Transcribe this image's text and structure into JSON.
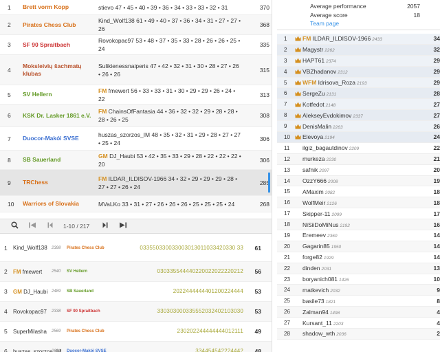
{
  "colors": {
    "title_gold": "#d59020",
    "accent_blue": "#3692e7",
    "team_green": "#629924",
    "team_orange": "#d87019"
  },
  "teams": [
    {
      "rank": "1",
      "name": "Brett vorm Kopp",
      "color": "c-orange",
      "players_title": "",
      "players": "stievo 47 • 45 • 40 • 39 • 36 • 34 • 33 • 33 • 32 • 31",
      "score": "370"
    },
    {
      "rank": "2",
      "name": "Pirates Chess Club",
      "color": "c-orange",
      "players_title": "",
      "players": "Kind_Wolf138 61 • 49 • 40 • 37 • 36 • 34 • 31 • 27 • 27 • 26",
      "score": "368"
    },
    {
      "rank": "3",
      "name": "SF 90 Spraitbach",
      "color": "c-red",
      "players_title": "",
      "players": "Rovokopac97 53 • 48 • 37 • 35 • 33 • 28 • 26 • 26 • 25 • 24",
      "score": "335"
    },
    {
      "rank": "4",
      "name": "Moksleivių šachmatų klubas",
      "color": "c-brown",
      "players_title": "",
      "players": "Sulikienessnaiperis 47 • 42 • 32 • 31 • 30 • 28 • 27 • 26 • 26 • 26",
      "score": "315"
    },
    {
      "rank": "5",
      "name": "SV Hellern",
      "color": "c-green",
      "players_title": "FM",
      "players": "fmewert 56 • 33 • 33 • 31 • 30 • 29 • 29 • 26 • 24 • 22",
      "score": "313"
    },
    {
      "rank": "6",
      "name": "KSK Dr. Lasker 1861 e.V.",
      "color": "c-green",
      "players_title": "FM",
      "players": "ChainsOfFantasia 44 • 36 • 32 • 32 • 29 • 28 • 28 • 28 • 26 • 25",
      "score": "308"
    },
    {
      "rank": "7",
      "name": "Duocor-Makói SVSE",
      "color": "c-blue",
      "players_title": "",
      "players": "huszas_szorzos_IM 48 • 35 • 32 • 31 • 29 • 28 • 27 • 27 • 25 • 24",
      "score": "306"
    },
    {
      "rank": "8",
      "name": "SB Sauerland",
      "color": "c-green",
      "players_title": "GM",
      "players": "DJ_Haubi 53 • 42 • 35 • 33 • 29 • 28 • 22 • 22 • 22 • 20",
      "score": "306"
    },
    {
      "rank": "9",
      "name": "TRChess",
      "color": "c-orange",
      "players_title": "FM",
      "players": "ILDAR_ILDISOV-1966 34 • 32 • 29 • 29 • 29 • 28 • 27 • 27 • 26 • 24",
      "score": "285"
    },
    {
      "rank": "10",
      "name": "Warriors of Slovakia",
      "color": "c-orange",
      "players_title": "",
      "players": "MVaLKo 33 • 31 • 27 • 26 • 26 • 26 • 25 • 25 • 25 • 24",
      "score": "268"
    }
  ],
  "pager": {
    "search_icon": "search-icon",
    "first_icon": "first-page-icon",
    "prev_icon": "prev-page-icon",
    "info": "1-10 / 217",
    "next_icon": "next-page-icon",
    "last_icon": "last-page-icon"
  },
  "players": [
    {
      "rank": "1",
      "title": "",
      "name": "Kind_Wolf138",
      "rating": "2398",
      "team": "Pirates Chess Club",
      "team_color": "c-orange",
      "scores": "033550330033003013011033420330 33",
      "total": "61"
    },
    {
      "rank": "2",
      "title": "FM",
      "name": "fmewert",
      "rating": "2540",
      "team": "SV Hellern",
      "team_color": "c-green",
      "scores": "030335544440220022022220212",
      "total": "56"
    },
    {
      "rank": "3",
      "title": "GM",
      "name": "DJ_Haubi",
      "rating": "2489",
      "team": "SB Sauerland",
      "team_color": "c-green",
      "scores": "2022444444401200224444",
      "total": "53"
    },
    {
      "rank": "4",
      "title": "",
      "name": "Rovokopac97",
      "rating": "2338",
      "team": "SF 90 Spraitbach",
      "team_color": "c-red",
      "scores": "330303000335552032402103030",
      "total": "53"
    },
    {
      "rank": "5",
      "title": "",
      "name": "SuperMilasha",
      "rating": "2569",
      "team": "Pirates Chess Club",
      "team_color": "c-orange",
      "scores": "230202244444444012111",
      "total": "49"
    },
    {
      "rank": "6",
      "title": "",
      "name": "huszas_szorzos_IM",
      "rating": "2621",
      "team": "Duocor-Makói SVSE",
      "team_color": "c-blue",
      "scores": "334454542224442",
      "total": "48"
    }
  ],
  "info": {
    "perf_label": "Average performance",
    "perf_value": "2057",
    "score_label": "Average score",
    "score_value": "18",
    "team_page": "Team page"
  },
  "ranking": [
    {
      "rank": "1",
      "crown": true,
      "title": "FM",
      "name": "ILDAR_ILDISOV-1966",
      "rating": "2433",
      "score": "34"
    },
    {
      "rank": "2",
      "crown": true,
      "title": "",
      "name": "Magystr",
      "rating": "2262",
      "score": "32"
    },
    {
      "rank": "3",
      "crown": true,
      "title": "",
      "name": "HAPT61",
      "rating": "2374",
      "score": "29"
    },
    {
      "rank": "4",
      "crown": true,
      "title": "",
      "name": "VBZhadanov",
      "rating": "2312",
      "score": "29"
    },
    {
      "rank": "5",
      "crown": true,
      "title": "WFM",
      "name": "Idrisova_Roza",
      "rating": "2193",
      "score": "29"
    },
    {
      "rank": "6",
      "crown": true,
      "title": "",
      "name": "SergeZu",
      "rating": "2131",
      "score": "28"
    },
    {
      "rank": "7",
      "crown": true,
      "title": "",
      "name": "Kotfedot",
      "rating": "2148",
      "score": "27"
    },
    {
      "rank": "8",
      "crown": true,
      "title": "",
      "name": "AlekseyEvdokimov",
      "rating": "2337",
      "score": "27"
    },
    {
      "rank": "9",
      "crown": true,
      "title": "",
      "name": "DenisMalin",
      "rating": "2263",
      "score": "26"
    },
    {
      "rank": "10",
      "crown": true,
      "title": "",
      "name": "Elevoya",
      "rating": "2194",
      "score": "24"
    },
    {
      "rank": "11",
      "crown": false,
      "title": "",
      "name": "ilgiz_bagautdinov",
      "rating": "2209",
      "score": "22"
    },
    {
      "rank": "12",
      "crown": false,
      "title": "",
      "name": "murkeza",
      "rating": "2230",
      "score": "21"
    },
    {
      "rank": "13",
      "crown": false,
      "title": "",
      "name": "safnik",
      "rating": "2097",
      "score": "20"
    },
    {
      "rank": "14",
      "crown": false,
      "title": "",
      "name": "OzzY666",
      "rating": "2008",
      "score": "19"
    },
    {
      "rank": "15",
      "crown": false,
      "title": "",
      "name": "AMaxim",
      "rating": "2082",
      "score": "18"
    },
    {
      "rank": "16",
      "crown": false,
      "title": "",
      "name": "WolfMeir",
      "rating": "2126",
      "score": "18"
    },
    {
      "rank": "17",
      "crown": false,
      "title": "",
      "name": "Skipper-11",
      "rating": "2099",
      "score": "17"
    },
    {
      "rank": "18",
      "crown": false,
      "title": "",
      "name": "NiSiiDoMiNus",
      "rating": "2192",
      "score": "16"
    },
    {
      "rank": "19",
      "crown": false,
      "title": "",
      "name": "Eremeev",
      "rating": "2360",
      "score": "14"
    },
    {
      "rank": "20",
      "crown": false,
      "title": "",
      "name": "Gagarin85",
      "rating": "1950",
      "score": "14"
    },
    {
      "rank": "21",
      "crown": false,
      "title": "",
      "name": "forge82",
      "rating": "1929",
      "score": "14"
    },
    {
      "rank": "22",
      "crown": false,
      "title": "",
      "name": "dinden",
      "rating": "2031",
      "score": "13"
    },
    {
      "rank": "23",
      "crown": false,
      "title": "",
      "name": "boryanich081",
      "rating": "1426",
      "score": "10"
    },
    {
      "rank": "24",
      "crown": false,
      "title": "",
      "name": "matkevich",
      "rating": "2032",
      "score": "9"
    },
    {
      "rank": "25",
      "crown": false,
      "title": "",
      "name": "basile73",
      "rating": "1821",
      "score": "8"
    },
    {
      "rank": "26",
      "crown": false,
      "title": "",
      "name": "Zalman94",
      "rating": "1498",
      "score": "4"
    },
    {
      "rank": "27",
      "crown": false,
      "title": "",
      "name": "Kursant_11",
      "rating": "2203",
      "score": "4"
    },
    {
      "rank": "28",
      "crown": false,
      "title": "",
      "name": "shadow_wth",
      "rating": "2036",
      "score": "2"
    }
  ]
}
